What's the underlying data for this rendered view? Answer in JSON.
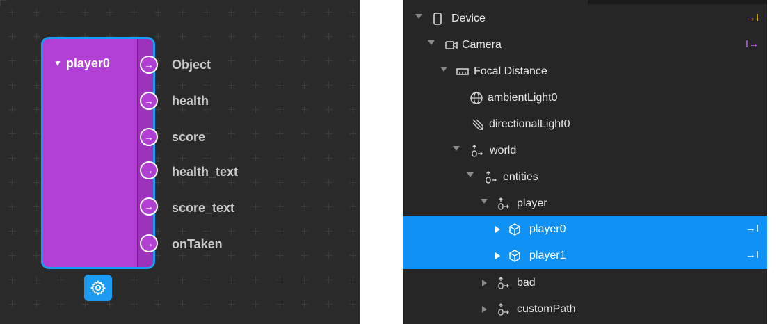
{
  "patch_editor": {
    "node": {
      "title": "player0",
      "outputs": [
        "Object",
        "health",
        "score",
        "health_text",
        "score_text",
        "onTaken"
      ]
    },
    "settings_icon": "gear-icon",
    "colors": {
      "node_fill": "#b23fd4",
      "selection_border": "#1c9bf2",
      "canvas": "#2a2a2a"
    }
  },
  "scene_tree": {
    "rows": [
      {
        "label": "Device",
        "icon": "device-icon",
        "trail": "→I",
        "trail_color": "#ffcc00"
      },
      {
        "label": "Camera",
        "icon": "camera-icon",
        "trail": "I→",
        "trail_color": "#d05cff"
      },
      {
        "label": "Focal Distance",
        "icon": "focal-distance-icon"
      },
      {
        "label": "ambientLight0",
        "icon": "globe-icon"
      },
      {
        "label": "directionalLight0",
        "icon": "directional-light-icon"
      },
      {
        "label": "world",
        "icon": "null-object-icon"
      },
      {
        "label": "entities",
        "icon": "null-object-icon"
      },
      {
        "label": "player",
        "icon": "null-object-icon"
      },
      {
        "label": "player0",
        "icon": "cube-icon",
        "trail": "→I",
        "selected": true
      },
      {
        "label": "player1",
        "icon": "cube-icon",
        "trail": "→I",
        "selected": true
      },
      {
        "label": "bad",
        "icon": "null-object-icon"
      },
      {
        "label": "customPath",
        "icon": "null-object-icon"
      }
    ],
    "colors": {
      "selection": "#0f91f5",
      "panel": "#262626"
    }
  }
}
